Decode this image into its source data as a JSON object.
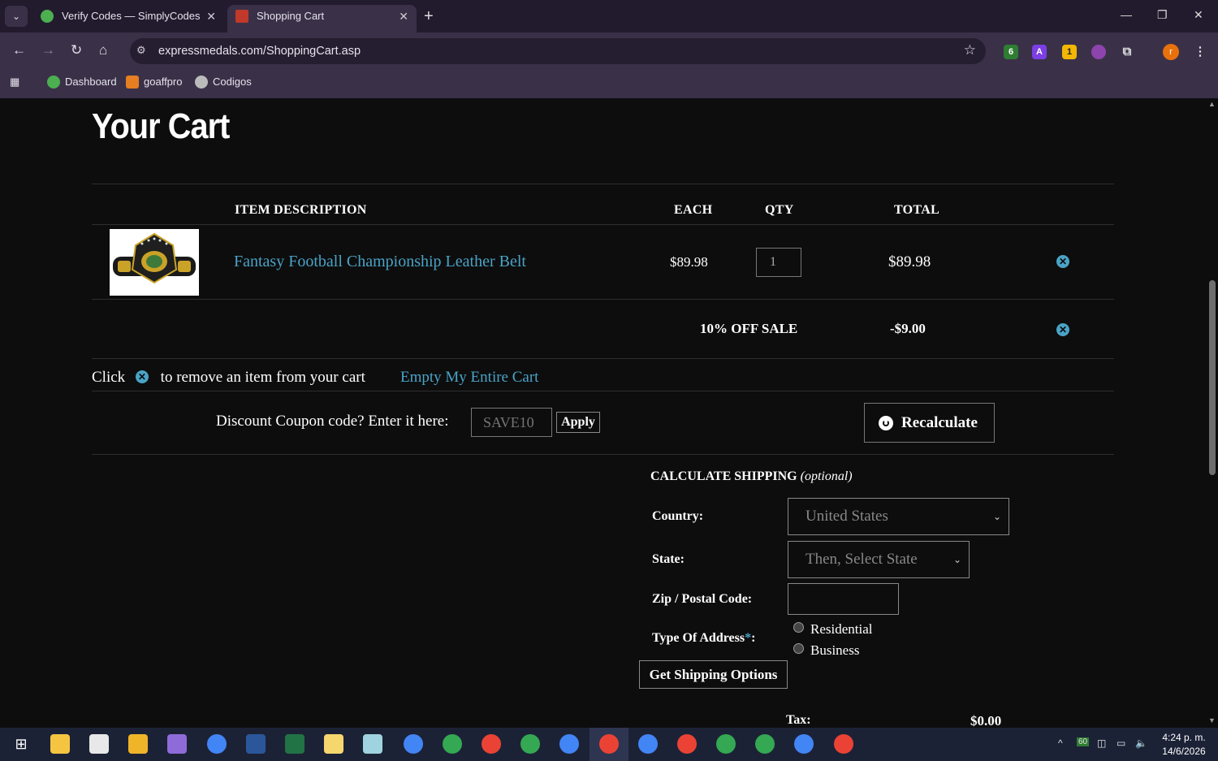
{
  "browser": {
    "tabs": [
      {
        "title": "Verify Codes — SimplyCodes",
        "active": false
      },
      {
        "title": "Shopping Cart",
        "active": true
      }
    ],
    "url": "expressmedals.com/ShoppingCart.asp",
    "bookmarks": [
      "Dashboard",
      "goaffpro",
      "Codigos"
    ],
    "extension_badges": [
      "6",
      "1"
    ],
    "profile_initial": "r"
  },
  "page": {
    "title": "Your Cart",
    "table_headers": {
      "item_description": "ITEM  DESCRIPTION",
      "each": "EACH",
      "qty": "QTY",
      "total": "TOTAL"
    },
    "items": [
      {
        "name": "Fantasy Football Championship Leather Belt",
        "each": "$89.98",
        "qty": "1",
        "total": "$89.98"
      }
    ],
    "discount": {
      "label": "10% OFF SALE",
      "amount": "-$9.00"
    },
    "help_prefix": "Click",
    "help_suffix": "to remove an item from your cart",
    "empty_cart": "Empty My Entire Cart",
    "coupon": {
      "label": "Discount Coupon code? Enter it here:",
      "placeholder": "SAVE10",
      "apply": "Apply"
    },
    "recalculate": "Recalculate",
    "shipping": {
      "heading": "CALCULATE SHIPPING",
      "heading_note": "(optional)",
      "country_label": "Country:",
      "country_value": "United States",
      "state_label": "State:",
      "state_value": "Then, Select State",
      "zip_label": "Zip / Postal Code:",
      "address_type_label": "Type Of Address",
      "address_type_required": "*",
      "address_type_colon": ":",
      "address_options": [
        "Residential",
        "Business"
      ],
      "get_options": "Get Shipping Options"
    },
    "tax": {
      "label": "Tax:",
      "value": "$0.00"
    }
  },
  "taskbar": {
    "battery": "60",
    "time": "4:24 p. m.",
    "date": "14/6/2026"
  },
  "colors": {
    "accent_link": "#4aa3c7",
    "page_bg": "#0d0d0d",
    "browser_bg": "#3a3148"
  }
}
